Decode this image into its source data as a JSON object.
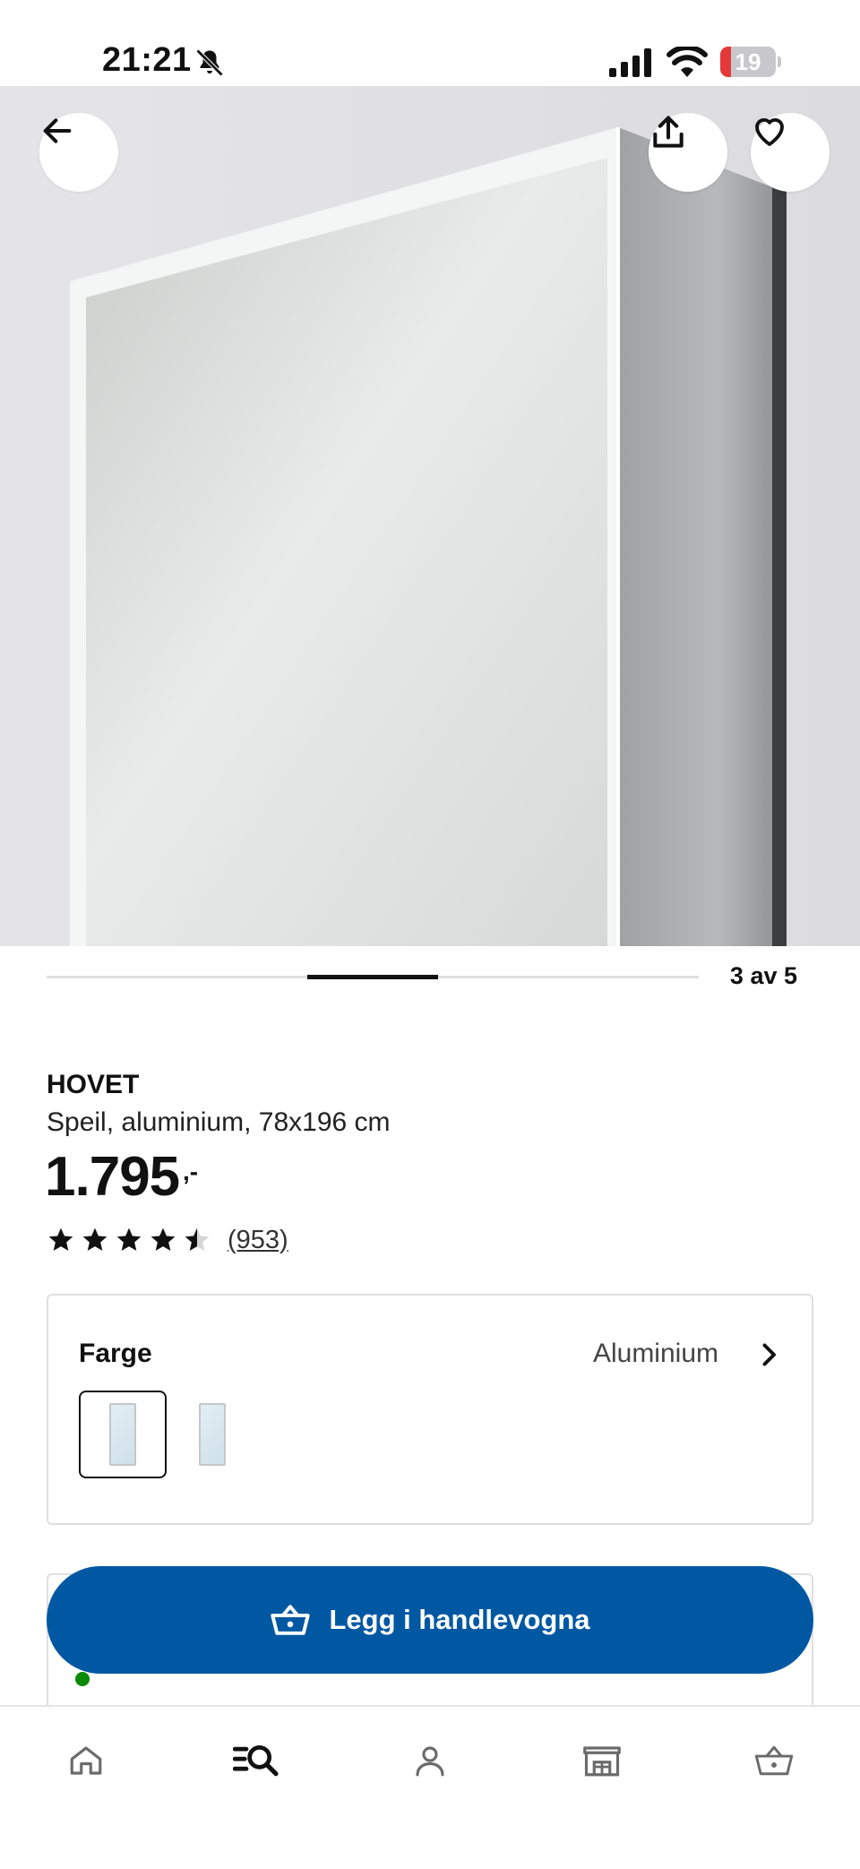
{
  "status_bar": {
    "time": "21:21",
    "battery_percent": "19",
    "battery_level": 0.19,
    "battery_color": "#e5383b",
    "icons": [
      "bell-slash-icon",
      "signal-icon",
      "wifi-icon",
      "battery-icon"
    ]
  },
  "hero": {
    "icons": [
      "back-arrow-icon",
      "share-icon",
      "heart-icon"
    ]
  },
  "carousel": {
    "current_index": 3,
    "total": 5,
    "indicator_text": "3 av 5"
  },
  "product": {
    "name": "HOVET",
    "description": "Speil, aluminium, 78x196 cm",
    "price": "1.795",
    "price_suffix": ",-",
    "rating_value": 4.5,
    "rating_max": 5,
    "review_count": "(953)"
  },
  "color_selector": {
    "label": "Farge",
    "selected_value": "Aluminium",
    "swatches": [
      "aluminium",
      "white"
    ],
    "selected_index": 0
  },
  "cta": {
    "add_to_cart_label": "Legg i handlevogna",
    "brand_color": "#0058a3"
  },
  "bottom_nav": {
    "items": [
      {
        "icon": "home-icon"
      },
      {
        "icon": "search-list-icon",
        "active": true
      },
      {
        "icon": "profile-icon"
      },
      {
        "icon": "store-icon"
      },
      {
        "icon": "cart-icon"
      }
    ]
  }
}
